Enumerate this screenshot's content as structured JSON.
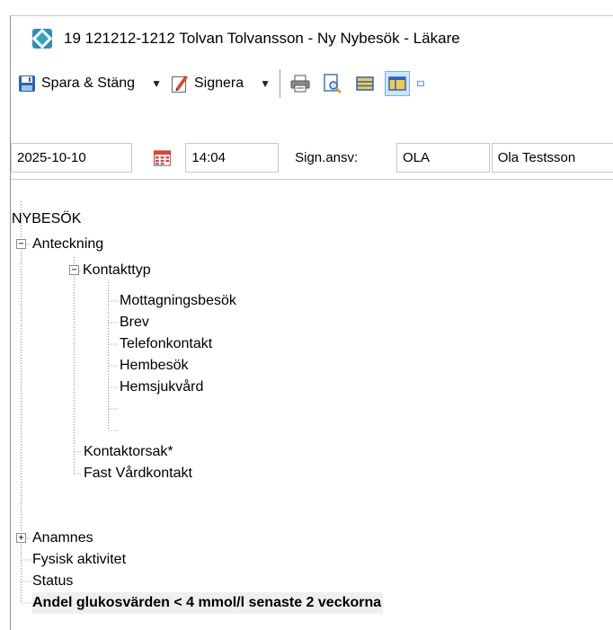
{
  "window": {
    "title": "19 121212-1212 Tolvan Tolvansson - Ny Nybesök - Läkare",
    "app_icon": "journal-app-icon"
  },
  "toolbar": {
    "save_close_label": "Spara & Stäng",
    "sign_label": "Signera",
    "icons": [
      "save-icon",
      "sign-pen-icon",
      "print-icon",
      "print-preview-icon",
      "layout-horizontal-icon",
      "layout-panes-icon"
    ]
  },
  "fields": {
    "date": "2025-10-10",
    "time": "14:04",
    "sign_label": "Sign.ansv:",
    "sign_code": "OLA",
    "sign_name": "Ola Testsson"
  },
  "tree": {
    "root": "NYBESÖK",
    "nodes": [
      {
        "label": "Anteckning",
        "expander": "−"
      },
      {
        "label": "Kontakttyp",
        "expander": "−"
      },
      {
        "label": "Mottagningsbesök"
      },
      {
        "label": "Brev"
      },
      {
        "label": "Telefonkontakt"
      },
      {
        "label": "Hembesök"
      },
      {
        "label": "Hemsjukvård"
      },
      {
        "label": "Kontaktorsak*"
      },
      {
        "label": "Fast Vårdkontakt"
      },
      {
        "label": "Anamnes",
        "expander": "+"
      },
      {
        "label": "Fysisk aktivitet"
      },
      {
        "label": "Status"
      },
      {
        "label": "Andel glukosvärden < 4 mmol/l senaste 2 veckorna"
      }
    ]
  },
  "colors": {
    "accent": "#2b7cc4",
    "selection_bg": "#efefef",
    "active_tool_bg": "#cfe4f7"
  }
}
